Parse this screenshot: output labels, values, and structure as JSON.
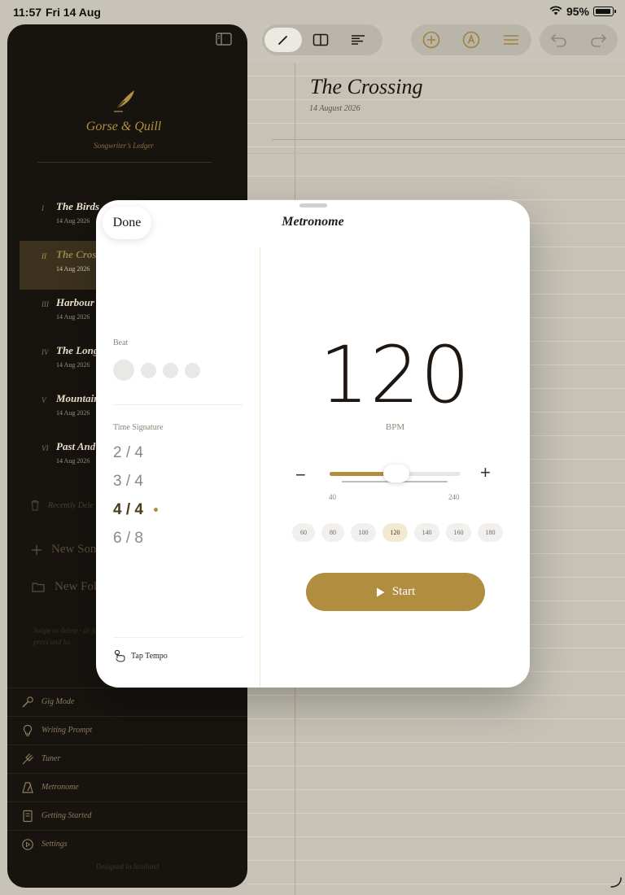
{
  "status_bar": {
    "time": "11:57",
    "date": "Fri 14 Aug",
    "battery": "95%"
  },
  "document": {
    "title": "The Crossing",
    "date": "14 August 2026"
  },
  "sidebar": {
    "brand": "Gorse & Quill",
    "brand_sub": "Songwriter’s Ledger",
    "songs": [
      {
        "num": "I",
        "title": "The Birds",
        "date": "14 Aug 2026"
      },
      {
        "num": "II",
        "title": "The Crossi",
        "date": "14 Aug 2026"
      },
      {
        "num": "III",
        "title": "Harbour I",
        "date": "14 Aug 2026"
      },
      {
        "num": "IV",
        "title": "The Long",
        "date": "14 Aug 2026"
      },
      {
        "num": "V",
        "title": "Mountain",
        "date": "14 Aug 2026"
      },
      {
        "num": "VI",
        "title": "Past And",
        "date": "14 Aug 2026"
      }
    ],
    "recently_deleted": "Recently Dele",
    "new_song": "New Song",
    "new_folder": "New Fol",
    "hint": "Swipe to delete · de folder · press and ho",
    "tools": [
      "Gig Mode",
      "Writing Prompt",
      "Tuner",
      "Metronome",
      "Getting Started",
      "Settings"
    ],
    "credit": "Designed In Scotland"
  },
  "metronome": {
    "title": "Metronome",
    "done": "Done",
    "beat_label": "Beat",
    "time_signature_label": "Time Signature",
    "time_signatures": [
      "2 / 4",
      "3 / 4",
      "4 / 4",
      "6 / 8"
    ],
    "selected_time_signature": "4 / 4",
    "tap_tempo": "Tap Tempo",
    "bpm": "120",
    "bpm_unit": "BPM",
    "minus": "−",
    "plus": "+",
    "range_min": "40",
    "range_max": "240",
    "slider_value": 120,
    "presets": [
      "60",
      "80",
      "100",
      "120",
      "140",
      "160",
      "180"
    ],
    "selected_preset": "120",
    "start": "Start"
  },
  "colors": {
    "accent": "#b08d3f",
    "sidebar_bg": "#17130f",
    "modal_bg": "#ffffff"
  }
}
